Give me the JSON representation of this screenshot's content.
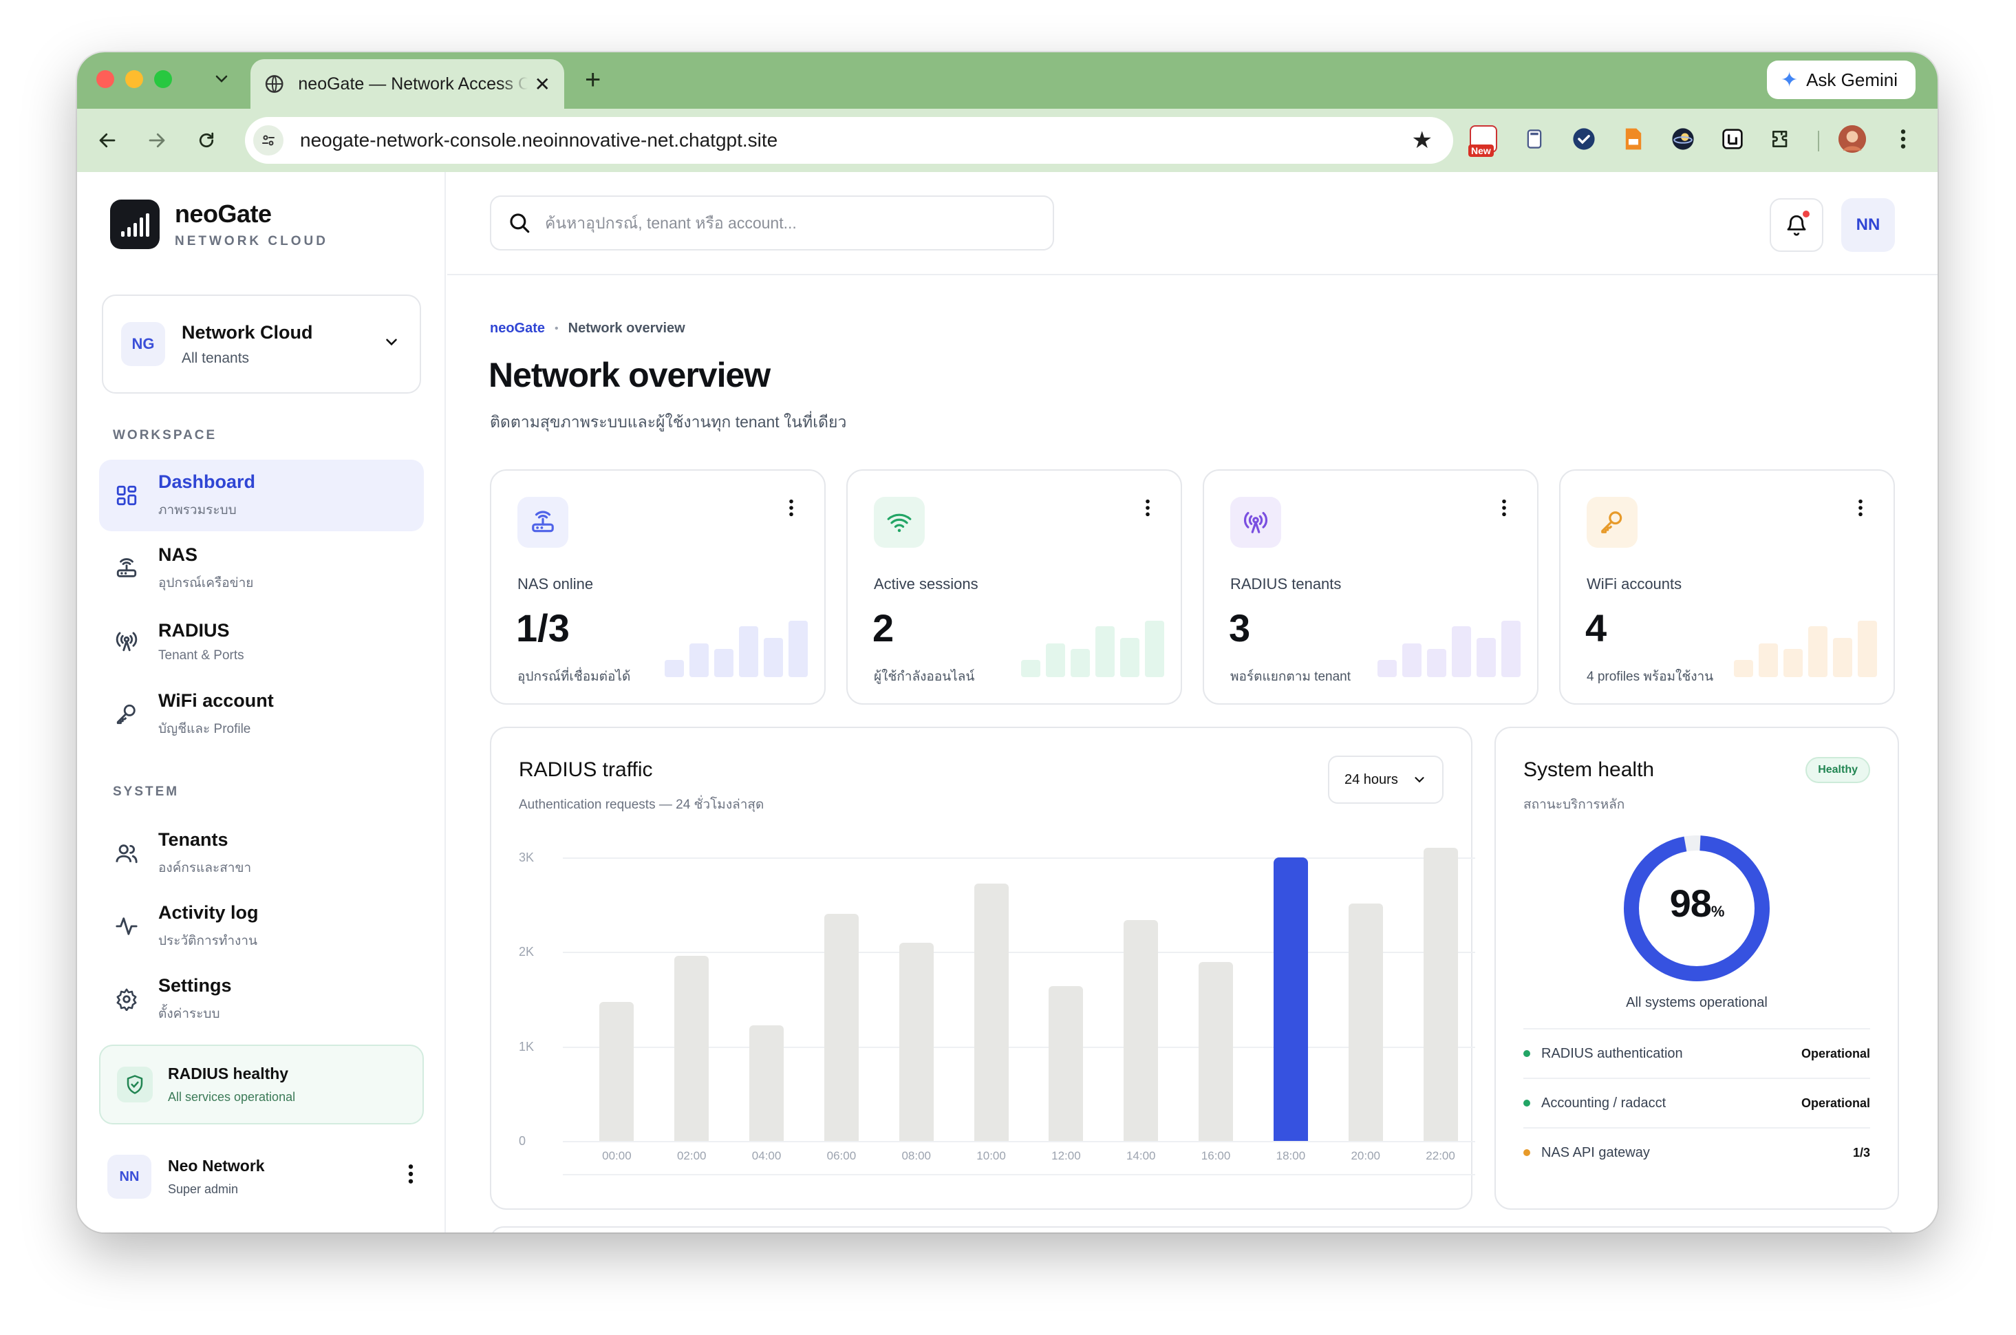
{
  "browser": {
    "tab_title": "neoGate — Network Access Console",
    "url": "neogate-network-console.neoinnovative-net.chatgpt.site",
    "gemini_label": "Ask Gemini",
    "new_badge": "New"
  },
  "brand": {
    "name": "neoGate",
    "subtitle": "NETWORK CLOUD"
  },
  "tenant_switcher": {
    "initials": "NG",
    "name": "Network Cloud",
    "scope": "All tenants"
  },
  "sidebar": {
    "workspace_label": "WORKSPACE",
    "system_label": "SYSTEM",
    "workspace_items": [
      {
        "label": "Dashboard",
        "sub": "ภาพรวมระบบ",
        "icon": "grid-icon"
      },
      {
        "label": "NAS",
        "sub": "อุปกรณ์เครือข่าย",
        "icon": "router-icon"
      },
      {
        "label": "RADIUS",
        "sub": "Tenant & Ports",
        "icon": "antenna-icon"
      },
      {
        "label": "WiFi account",
        "sub": "บัญชีและ Profile",
        "icon": "key-icon"
      }
    ],
    "system_items": [
      {
        "label": "Tenants",
        "sub": "องค์กรและสาขา",
        "icon": "users-icon"
      },
      {
        "label": "Activity log",
        "sub": "ประวัติการทำงาน",
        "icon": "activity-icon"
      },
      {
        "label": "Settings",
        "sub": "ตั้งค่าระบบ",
        "icon": "gear-icon"
      }
    ],
    "health": {
      "title": "RADIUS healthy",
      "sub": "All services operational"
    },
    "user": {
      "initials": "NN",
      "name": "Neo Network",
      "role": "Super admin"
    }
  },
  "topbar": {
    "search_placeholder": "ค้นหาอุปกรณ์, tenant หรือ account...",
    "avatar_initials": "NN"
  },
  "breadcrumb": {
    "root": "neoGate",
    "current": "Network overview"
  },
  "page": {
    "title": "Network overview",
    "subtitle": "ติดตามสุขภาพระบบและผู้ใช้งานทุก tenant ในที่เดียว"
  },
  "stats": [
    {
      "label": "NAS online",
      "value": "1/3",
      "note": "อุปกรณ์ที่เชื่อมต่อได้",
      "icon": "router-icon",
      "accent": "#4f63e8",
      "tint": "#eef0fd",
      "bar_color": "#e7e9fc",
      "sparkline": [
        0.3,
        0.6,
        0.5,
        0.9,
        0.7,
        1.0
      ]
    },
    {
      "label": "Active sessions",
      "value": "2",
      "note": "ผู้ใช้กำลังออนไลน์",
      "icon": "wifi-icon",
      "accent": "#22a565",
      "tint": "#e9f7ef",
      "bar_color": "#e3f6ec",
      "sparkline": [
        0.3,
        0.6,
        0.5,
        0.9,
        0.7,
        1.0
      ]
    },
    {
      "label": "RADIUS tenants",
      "value": "3",
      "note": "พอร์ตแยกตาม tenant",
      "icon": "antenna-icon",
      "accent": "#7a4fe0",
      "tint": "#f1ecfc",
      "bar_color": "#ece8fb",
      "sparkline": [
        0.3,
        0.6,
        0.5,
        0.9,
        0.7,
        1.0
      ]
    },
    {
      "label": "WiFi accounts",
      "value": "4",
      "note": "4 profiles พร้อมใช้งาน",
      "icon": "key-icon",
      "accent": "#e79a2a",
      "tint": "#fdf3e4",
      "bar_color": "#fdf0e0",
      "sparkline": [
        0.3,
        0.6,
        0.5,
        0.9,
        0.7,
        1.0
      ]
    }
  ],
  "traffic": {
    "title": "RADIUS traffic",
    "subtitle": "Authentication requests — 24 ชั่วโมงล่าสุด",
    "range_label": "24 hours"
  },
  "chart_data": {
    "type": "bar",
    "title": "RADIUS traffic",
    "categories": [
      "00:00",
      "02:00",
      "04:00",
      "06:00",
      "08:00",
      "10:00",
      "12:00",
      "14:00",
      "16:00",
      "18:00",
      "20:00",
      "22:00"
    ],
    "values": [
      1470,
      1960,
      1220,
      2400,
      2100,
      2720,
      1640,
      2340,
      1890,
      3000,
      2510,
      3100
    ],
    "y_ticks": [
      "0",
      "1K",
      "2K",
      "3K"
    ],
    "ylim": [
      0,
      3000
    ],
    "highlight_index": 9,
    "highlight_color": "#3652e0",
    "bar_color": "#e7e7e4",
    "grid": true
  },
  "health": {
    "title": "System health",
    "subtitle": "สถานะบริการหลัก",
    "badge": "Healthy",
    "percent": 98,
    "percent_value": "98",
    "percent_unit": "%",
    "caption": "All systems operational",
    "ring_color": "#3652e0",
    "services": [
      {
        "name": "RADIUS authentication",
        "status": "Operational",
        "color": "#22a565"
      },
      {
        "name": "Accounting / radacct",
        "status": "Operational",
        "color": "#22a565"
      },
      {
        "name": "NAS API gateway",
        "status": "1/3",
        "color": "#e79a2a"
      }
    ]
  }
}
